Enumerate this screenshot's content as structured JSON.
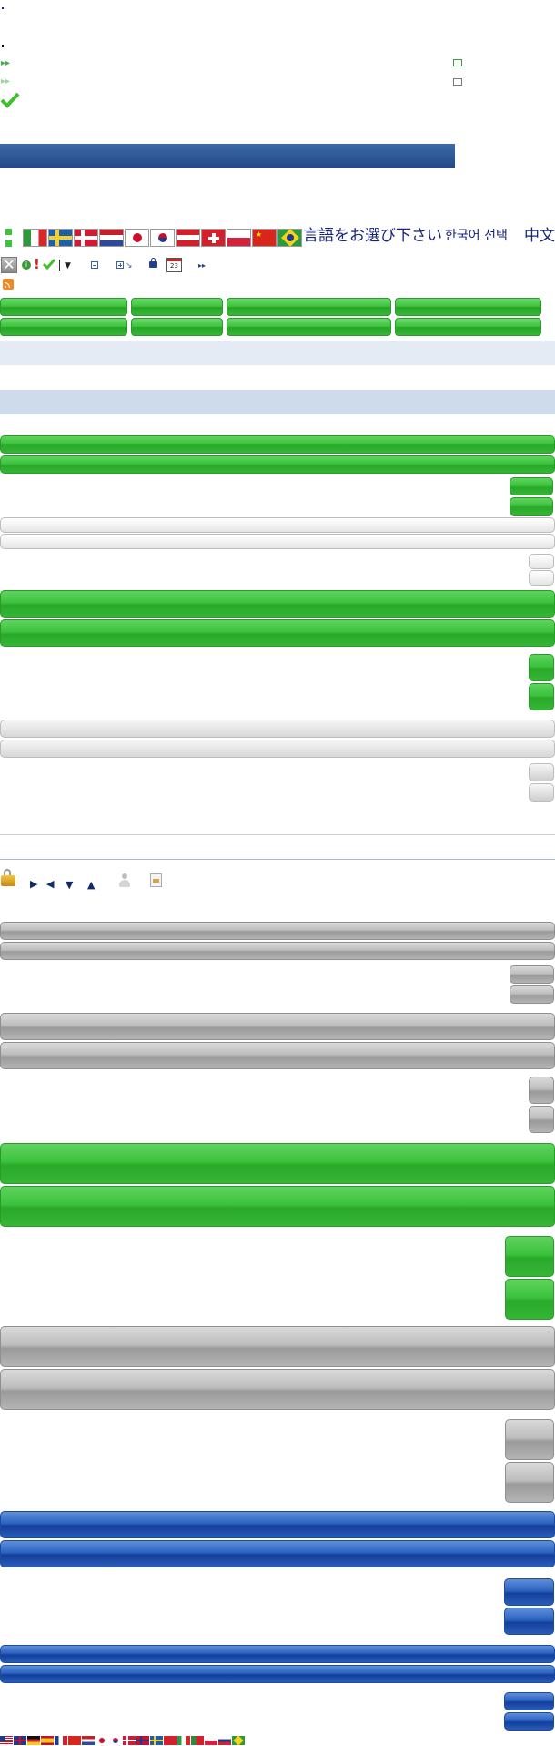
{
  "language_bar": {
    "japanese_prompt": "言語をお選び下さい",
    "korean_prompt": "한국어 선택",
    "chinese_prompt": "中文"
  },
  "toolbar": {
    "calendar_day": "23"
  },
  "colors": {
    "navy_bar": "#2b5590",
    "green_accent": "#3cc23c",
    "blue_accent": "#2c62c0",
    "band_light": "#e4ebf5",
    "band_mid": "#cedbea"
  },
  "icons": [
    "bullet-icon",
    "arrow-right-double-icon",
    "envelope-icon",
    "checkmark-icon",
    "plus-icon",
    "close-icon",
    "info-icon",
    "exclamation-icon",
    "pipe-separator-icon",
    "dropdown-arrow-icon",
    "minus-box-icon",
    "plus-box-icon",
    "lock-icon",
    "calendar-icon",
    "rss-icon",
    "padlock-icon",
    "arrow-right-icon",
    "arrow-left-icon",
    "arrow-down-icon",
    "arrow-up-icon",
    "user-icon",
    "document-icon"
  ]
}
